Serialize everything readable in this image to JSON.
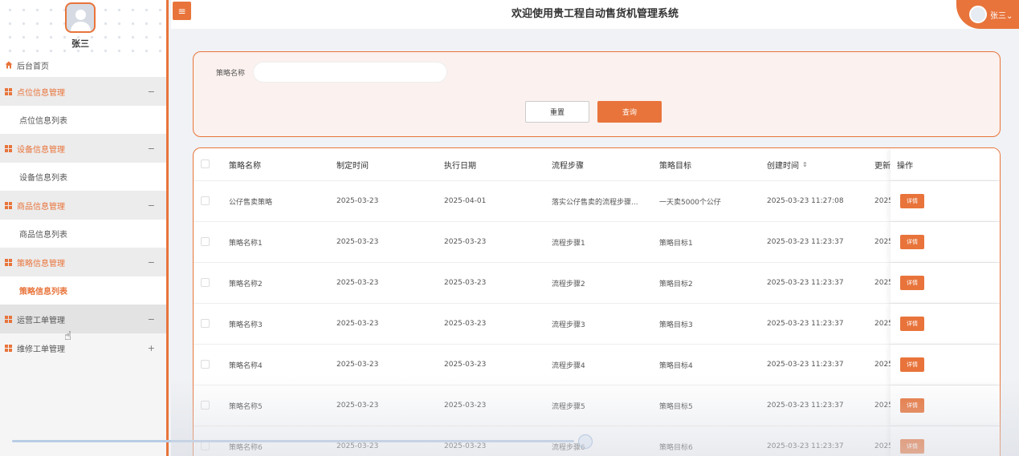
{
  "app": {
    "title": "欢迎使用贵工程自动售货机管理系统",
    "user_chip_label": "张三⌄",
    "accent_color": "#e8743b"
  },
  "sidebar": {
    "user_name": "张三",
    "home": "后台首页",
    "groups": [
      {
        "label": "点位信息管理",
        "toggle": "−",
        "sub": "点位信息列表"
      },
      {
        "label": "设备信息管理",
        "toggle": "−",
        "sub": "设备信息列表"
      },
      {
        "label": "商品信息管理",
        "toggle": "−",
        "sub": "商品信息列表"
      },
      {
        "label": "策略信息管理",
        "toggle": "−",
        "sub": "策略信息列表"
      },
      {
        "label": "运营工单管理",
        "toggle": "−"
      },
      {
        "label": "维修工单管理",
        "toggle": "+"
      }
    ]
  },
  "search": {
    "label": "策略名称",
    "value": "",
    "reset_label": "重置",
    "query_label": "查询"
  },
  "table": {
    "columns": [
      "策略名称",
      "制定时间",
      "执行日期",
      "流程步骤",
      "策略目标",
      "创建时间",
      "更新",
      "操作"
    ],
    "detail_label": "详情",
    "rows": [
      {
        "name": "公仔售卖策略",
        "made": "2025-03-23",
        "exec": "2025-04-01",
        "steps": "落实公仔售卖的流程步骤...",
        "goal": "一天卖5000个公仔",
        "created": "2025-03-23 11:27:08",
        "updated": "2025"
      },
      {
        "name": "策略名称1",
        "made": "2025-03-23",
        "exec": "2025-03-23",
        "steps": "流程步骤1",
        "goal": "策略目标1",
        "created": "2025-03-23 11:23:37",
        "updated": "2025"
      },
      {
        "name": "策略名称2",
        "made": "2025-03-23",
        "exec": "2025-03-23",
        "steps": "流程步骤2",
        "goal": "策略目标2",
        "created": "2025-03-23 11:23:37",
        "updated": "2025"
      },
      {
        "name": "策略名称3",
        "made": "2025-03-23",
        "exec": "2025-03-23",
        "steps": "流程步骤3",
        "goal": "策略目标3",
        "created": "2025-03-23 11:23:37",
        "updated": "2025"
      },
      {
        "name": "策略名称4",
        "made": "2025-03-23",
        "exec": "2025-03-23",
        "steps": "流程步骤4",
        "goal": "策略目标4",
        "created": "2025-03-23 11:23:37",
        "updated": "2025"
      },
      {
        "name": "策略名称5",
        "made": "2025-03-23",
        "exec": "2025-03-23",
        "steps": "流程步骤5",
        "goal": "策略目标5",
        "created": "2025-03-23 11:23:37",
        "updated": "2025"
      },
      {
        "name": "策略名称6",
        "made": "2025-03-23",
        "exec": "2025-03-23",
        "steps": "流程步骤6",
        "goal": "策略目标6",
        "created": "2025-03-23 11:23:37",
        "updated": "2025"
      }
    ]
  }
}
